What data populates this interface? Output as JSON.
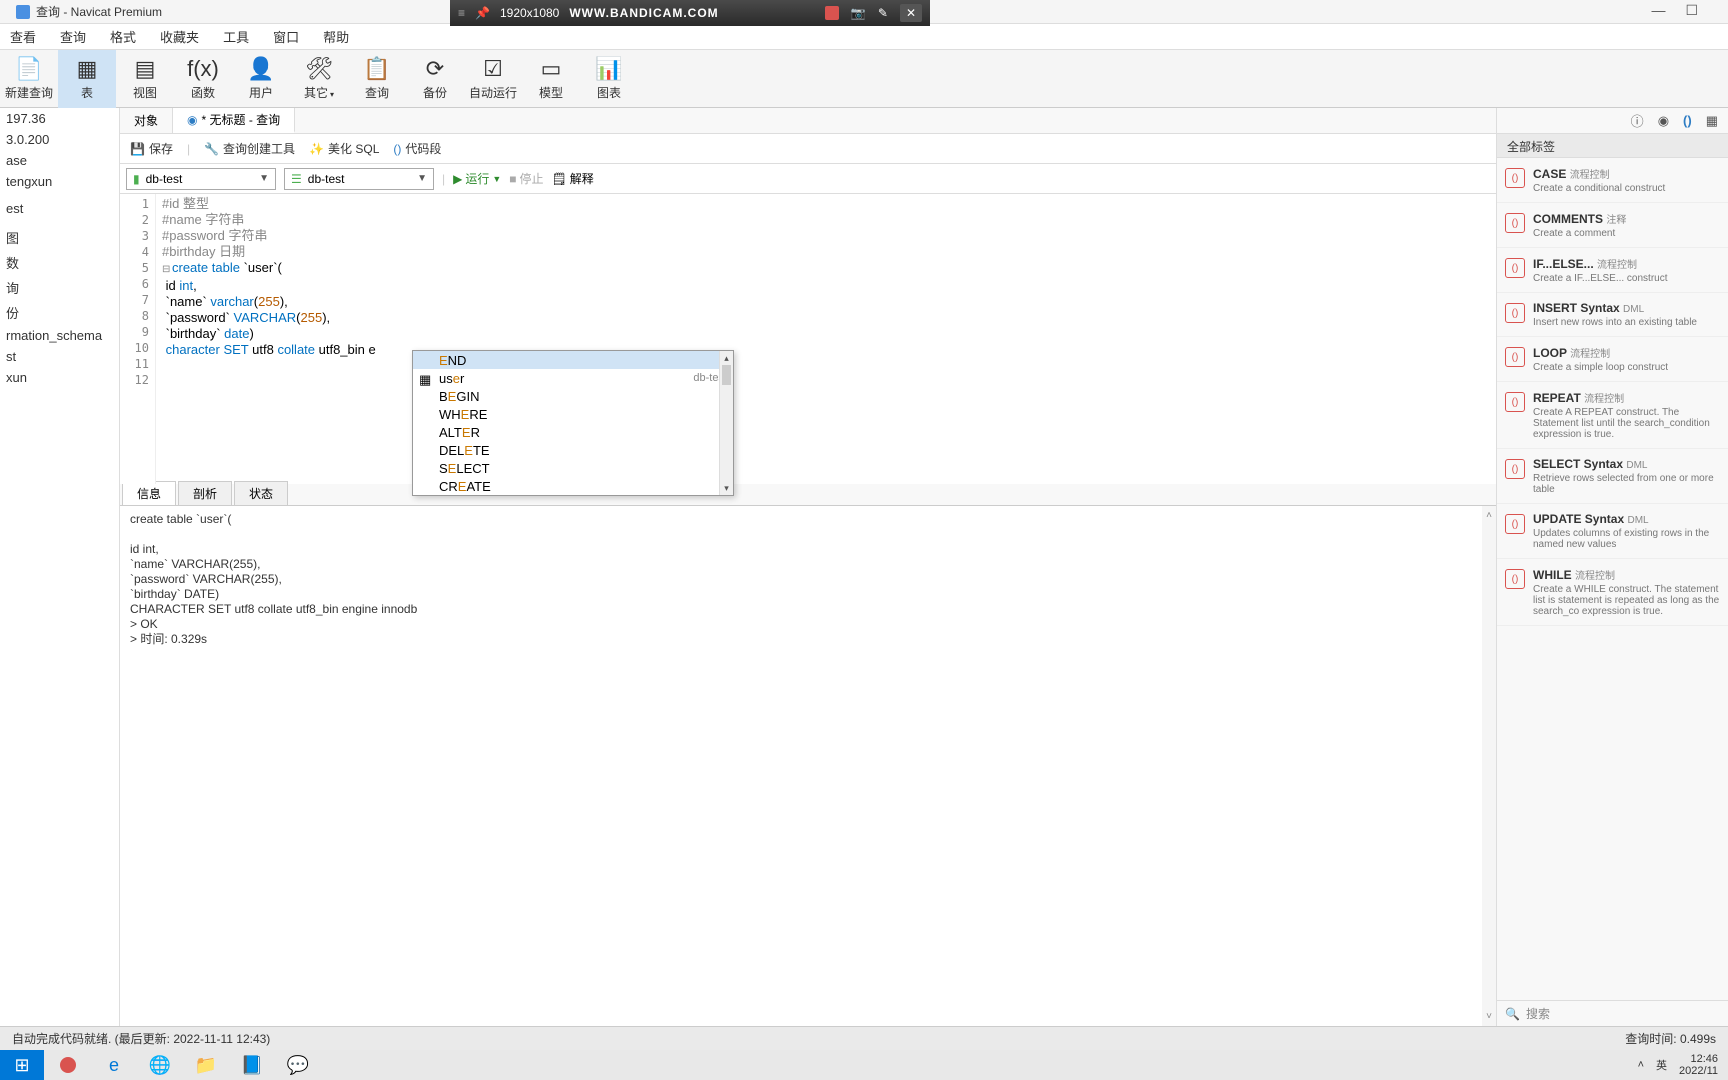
{
  "title": "查询 - Navicat Premium",
  "bandicam": {
    "res": "1920x1080",
    "logo": "WWW.BANDICAM.COM"
  },
  "menu": [
    "查看",
    "查询",
    "格式",
    "收藏夹",
    "工具",
    "窗口",
    "帮助"
  ],
  "toolbar": [
    {
      "label": "新建查询",
      "icon": "📄"
    },
    {
      "label": "表",
      "icon": "▦"
    },
    {
      "label": "视图",
      "icon": "▤"
    },
    {
      "label": "函数",
      "icon": "f(x)"
    },
    {
      "label": "用户",
      "icon": "👤"
    },
    {
      "label": "其它",
      "icon": "🛠"
    },
    {
      "label": "查询",
      "icon": "📋"
    },
    {
      "label": "备份",
      "icon": "⟳"
    },
    {
      "label": "自动运行",
      "icon": "☑"
    },
    {
      "label": "模型",
      "icon": "▭"
    },
    {
      "label": "图表",
      "icon": "📊"
    }
  ],
  "sidebar": [
    "197.36",
    "3.0.200",
    "ase",
    "tengxun",
    "",
    "est",
    "",
    "图",
    "数",
    "询",
    "份",
    "rmation_schema",
    "st",
    "xun"
  ],
  "tabs": {
    "obj": "对象",
    "query": "* 无标题 - 查询"
  },
  "subtoolbar": {
    "save": "保存",
    "qbuilder": "查询创建工具",
    "beautify": "美化 SQL",
    "snippet": "代码段"
  },
  "db1": "db-test",
  "db2": "db-test",
  "run": "运行",
  "stop": "停止",
  "explain": "解释",
  "code_lines": [
    {
      "n": "1",
      "html": "<span class='c-comment'>#id 整型</span>"
    },
    {
      "n": "2",
      "html": "<span class='c-comment'>#name 字符串</span>"
    },
    {
      "n": "3",
      "html": "<span class='c-comment'>#password 字符串</span>"
    },
    {
      "n": "4",
      "html": "<span class='c-comment'>#birthday 日期</span>"
    },
    {
      "n": "5",
      "html": "<span class='fold'>⊟</span><span class='c-kw'>create</span> <span class='c-kw'>table</span> `user`("
    },
    {
      "n": "6",
      "html": " id <span class='c-type'>int</span>,"
    },
    {
      "n": "7",
      "html": " `name` <span class='c-type'>varchar</span>(<span class='c-num'>255</span>),"
    },
    {
      "n": "8",
      "html": " `password` <span class='c-type'>VARCHAR</span>(<span class='c-num'>255</span>),"
    },
    {
      "n": "9",
      "html": " `birthday` <span class='c-type'>date</span>)"
    },
    {
      "n": "10",
      "html": " <span class='c-kw'>character</span> <span class='c-kw'>SET</span> utf8 <span class='c-kw'>collate</span> utf8_bin e"
    },
    {
      "n": "11",
      "html": ""
    },
    {
      "n": "12",
      "html": ""
    }
  ],
  "autocomplete": [
    {
      "text": "END",
      "sel": true,
      "hlpos": 0
    },
    {
      "text": "user",
      "icon": "tbl",
      "right": "db-test",
      "hlpos": 2
    },
    {
      "text": "BEGIN",
      "hlpos": 1
    },
    {
      "text": "WHERE",
      "hlpos": 2
    },
    {
      "text": "ALTER",
      "hlpos": 3
    },
    {
      "text": "DELETE",
      "hlpos": 3
    },
    {
      "text": "SELECT",
      "hlpos": 1
    },
    {
      "text": "CREATE",
      "hlpos": 2
    }
  ],
  "subtabs": [
    "信息",
    "剖析",
    "状态"
  ],
  "output": "create table `user`(\n\nid int,\n`name` VARCHAR(255),\n`password` VARCHAR(255),\n`birthday` DATE)\nCHARACTER SET utf8 collate utf8_bin engine innodb\n> OK\n> 时间: 0.329s",
  "rp_header": "全部标签",
  "rp_items": [
    {
      "title": "CASE",
      "cat": "流程控制",
      "desc": "Create a conditional construct"
    },
    {
      "title": "COMMENTS",
      "cat": "注释",
      "desc": "Create a comment"
    },
    {
      "title": "IF...ELSE...",
      "cat": "流程控制",
      "desc": "Create a IF...ELSE... construct"
    },
    {
      "title": "INSERT Syntax",
      "cat": "DML",
      "desc": "Insert new rows into an existing table"
    },
    {
      "title": "LOOP",
      "cat": "流程控制",
      "desc": "Create a simple loop construct"
    },
    {
      "title": "REPEAT",
      "cat": "流程控制",
      "desc": "Create A REPEAT construct. The Statement list until the search_condition expression is true."
    },
    {
      "title": "SELECT Syntax",
      "cat": "DML",
      "desc": "Retrieve rows selected from one or more table"
    },
    {
      "title": "UPDATE Syntax",
      "cat": "DML",
      "desc": "Updates columns of existing rows in the named new values"
    },
    {
      "title": "WHILE",
      "cat": "流程控制",
      "desc": "Create a WHILE construct. The statement list is statement is repeated as long as the search_co expression is true."
    }
  ],
  "rp_search": "搜索",
  "status_left": "自动完成代码就绪. (最后更新: 2022-11-11 12:43)",
  "status_right": "查询时间: 0.499s",
  "ime": "英",
  "clock": {
    "time": "12:46",
    "date": "2022/11"
  }
}
